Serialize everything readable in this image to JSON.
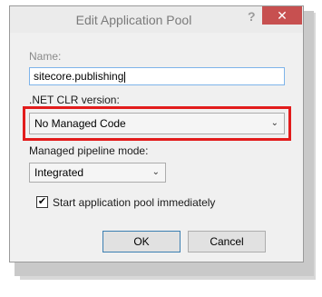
{
  "dialog": {
    "title": "Edit Application Pool",
    "help_label": "?",
    "close_glyph": "✕",
    "name_label": "Name:",
    "name_value": "sitecore.publishing",
    "clr_label": ".NET CLR version:",
    "clr_selected": "No Managed Code",
    "pipeline_label": "Managed pipeline mode:",
    "pipeline_selected": "Integrated",
    "start_immediately_label": "Start application pool immediately",
    "start_immediately_checked": true,
    "check_glyph": "✔",
    "chevron_glyph": "⌄",
    "ok_label": "OK",
    "cancel_label": "Cancel"
  },
  "colors": {
    "highlight": "#e21c1c",
    "close_button": "#c75050",
    "focus_border": "#7eb4ea"
  }
}
